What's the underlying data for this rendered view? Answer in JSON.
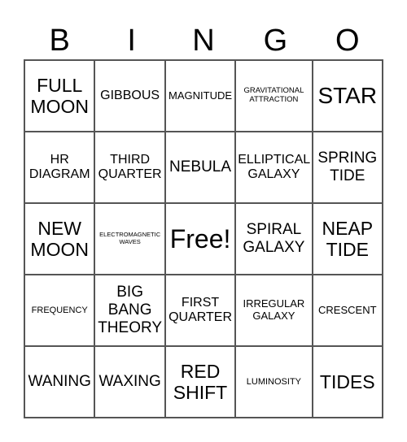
{
  "header": [
    "B",
    "I",
    "N",
    "G",
    "O"
  ],
  "cells": [
    "FULL MOON",
    "GIBBOUS",
    "MAGNITUDE",
    "GRAVITATIONAL ATTRACTION",
    "STAR",
    "HR DIAGRAM",
    "THIRD QUARTER",
    "NEBULA",
    "ELLIPTICAL GALAXY",
    "SPRING TIDE",
    "NEW MOON",
    "ELECTROMAGNETIC WAVES",
    "Free!",
    "SPIRAL GALAXY",
    "NEAP TIDE",
    "FREQUENCY",
    "BIG BANG THEORY",
    "FIRST QUARTER",
    "IRREGULAR GALAXY",
    "CRESCENT",
    "WANING",
    "WAXING",
    "RED SHIFT",
    "LUMINOSITY",
    "TIDES"
  ]
}
